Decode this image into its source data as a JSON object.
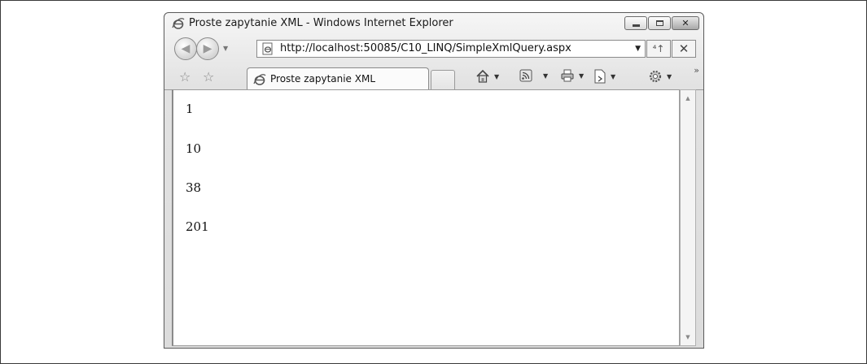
{
  "window": {
    "title": "Proste zapytanie XML - Windows Internet Explorer",
    "controls": {
      "minimize": "minimize",
      "maximize": "maximize",
      "close": "✕"
    }
  },
  "navbar": {
    "address_url": "http://localhost:50085/C10_LINQ/SimpleXmlQuery.aspx",
    "refresh_glyph": "⁴↑",
    "stop_glyph": "✕"
  },
  "tabbar": {
    "active_tab_label": "Proste zapytanie XML",
    "overflow_glyph": "»"
  },
  "content": {
    "values": [
      "1",
      "10",
      "38",
      "201"
    ]
  },
  "icons": {
    "ie": "ie-logo-icon",
    "page": "page-icon",
    "home": "home-icon",
    "feeds": "rss-icon",
    "print": "print-icon",
    "page_menu": "page-menu-icon",
    "tools": "gear-icon"
  }
}
